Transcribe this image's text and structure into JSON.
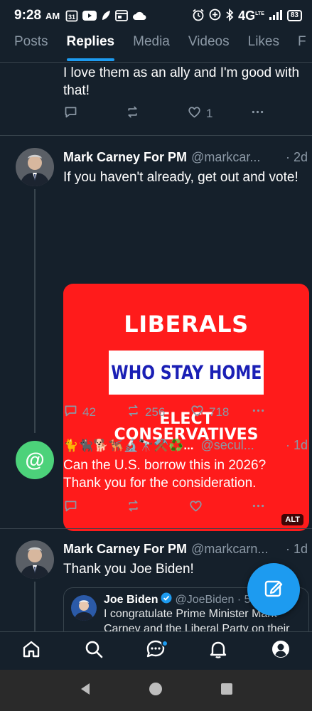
{
  "status_bar": {
    "time": "9:28",
    "ampm": "AM",
    "calendar": "31",
    "network": "4G",
    "network_sup": "LTE",
    "battery": "83"
  },
  "tabs": [
    {
      "label": "Posts"
    },
    {
      "label": "Replies"
    },
    {
      "label": "Media"
    },
    {
      "label": "Videos"
    },
    {
      "label": "Likes"
    },
    {
      "label": "F"
    }
  ],
  "active_tab": "Replies",
  "tweets": [
    {
      "text": "I love them as an ally and I'm good with that!",
      "likes": "1"
    },
    {
      "name": "Mark Carney For PM",
      "handle": "@markcar...",
      "time": "· 2d",
      "text": "If you haven't already, get out and vote!",
      "media": {
        "line1": "LIBERALS",
        "line2": "WHO STAY HOME",
        "line3": "ELECT",
        "line4": "CONSERVATIVES",
        "alt": "ALT"
      },
      "replies": "42",
      "retweets": "256",
      "likes": "718"
    },
    {
      "name": "🐈🐈‍⬛🐕🐕‍🦺🔬🔭⚒️♻️...",
      "handle": "@secul...",
      "time": "· 1d",
      "avatar_symbol": "@",
      "text": "Can the U.S. borrow this in 2026? Thank you for the consideration."
    },
    {
      "name": "Mark Carney For PM",
      "handle": "@markcarn...",
      "time": "· 1d",
      "text": "Thank you Joe Biden!",
      "quote": {
        "name": "Joe Biden",
        "handle": "@JoeBiden · 58",
        "text": "I congratulate Prime Minister Mark Carney and the Liberal Party on their"
      }
    }
  ],
  "colors": {
    "background": "#15202b",
    "accent": "#1d9bf0",
    "muted": "#8b98a5",
    "media_red": "#ff1b1b",
    "media_blue_text": "#1a1fb5",
    "avatar_green": "#4cd27a"
  }
}
